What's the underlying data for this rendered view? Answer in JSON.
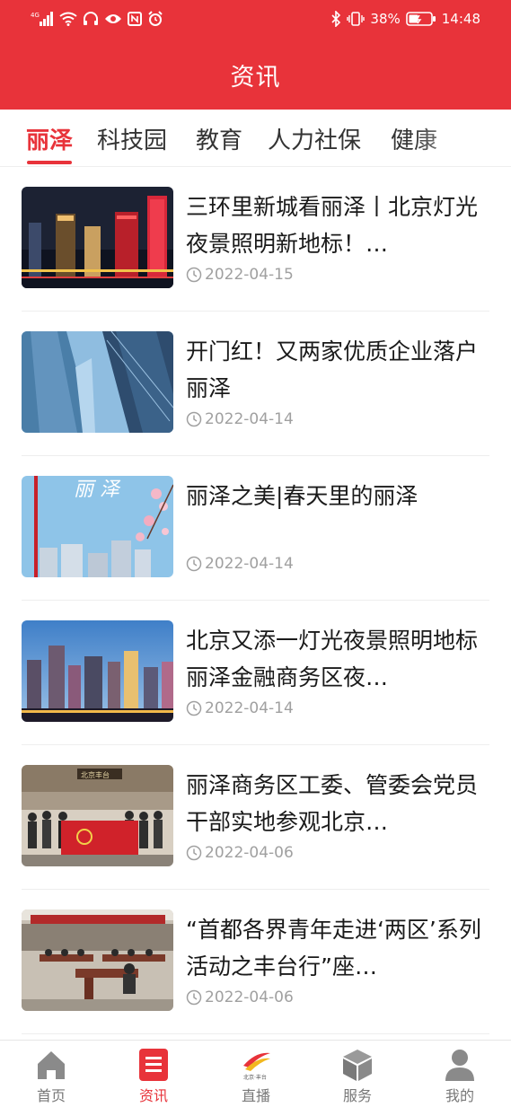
{
  "status_bar": {
    "left_icons": [
      "signal-icon",
      "wifi-icon",
      "headphones-icon",
      "eye-icon",
      "nfc-icon",
      "alarm-icon"
    ],
    "network_label": "4G",
    "battery": "38%",
    "time": "14:48"
  },
  "header": {
    "title": "资讯"
  },
  "tabs": [
    {
      "label": "丽泽",
      "active": true
    },
    {
      "label": "科技园",
      "active": false
    },
    {
      "label": "教育",
      "active": false
    },
    {
      "label": "人力社保",
      "active": false
    },
    {
      "label": "健康",
      "active": false
    }
  ],
  "news": [
    {
      "title": "三环里新城看丽泽丨北京灯光夜景照明新地标！…",
      "date": "2022-04-15",
      "thumb": "city-night-icon"
    },
    {
      "title": "开门红！又两家优质企业落户丽泽",
      "date": "2022-04-14",
      "thumb": "glass-towers-icon"
    },
    {
      "title": "丽泽之美|春天里的丽泽",
      "date": "2022-04-14",
      "thumb": "spring-blossom-icon"
    },
    {
      "title": "北京又添一灯光夜景照明地标 丽泽金融商务区夜…",
      "date": "2022-04-14",
      "thumb": "city-dusk-icon"
    },
    {
      "title": "丽泽商务区工委、管委会党员干部实地参观北京…",
      "date": "2022-04-06",
      "thumb": "group-photo-icon"
    },
    {
      "title": "“首都各界青年走进‘两区’系列活动之丰台行”座…",
      "date": "2022-04-06",
      "thumb": "meeting-room-icon"
    }
  ],
  "thumb_texts": {
    "spring": "丽 泽",
    "banner": "北京丰台"
  },
  "bottom_nav": [
    {
      "label": "首页",
      "icon": "home-icon",
      "active": false
    },
    {
      "label": "资讯",
      "icon": "news-icon",
      "active": true
    },
    {
      "label": "直播",
      "icon": "live-logo-icon",
      "active": false,
      "logo_text": "北京·丰台"
    },
    {
      "label": "服务",
      "icon": "cube-icon",
      "active": false
    },
    {
      "label": "我的",
      "icon": "profile-icon",
      "active": false
    }
  ],
  "colors": {
    "accent": "#e8333a",
    "text": "#1a1a1a",
    "muted": "#a0a0a0"
  }
}
